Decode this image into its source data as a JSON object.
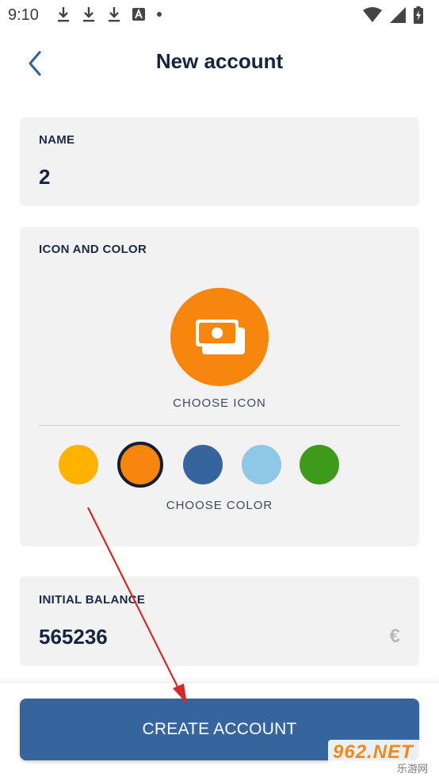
{
  "status_bar": {
    "time": "9:10",
    "left_icons": [
      "download-icon",
      "download-icon",
      "download-icon",
      "keyboard-a-icon",
      "dot-icon"
    ],
    "right_icons": [
      "wifi-icon",
      "signal-icon",
      "battery-charging-icon"
    ]
  },
  "header": {
    "title": "New account",
    "back_icon": "chevron-left-icon"
  },
  "name_section": {
    "label": "NAME",
    "value": "2"
  },
  "icon_section": {
    "label": "ICON AND COLOR",
    "icon": "money-stack-icon",
    "choose_icon_label": "CHOOSE ICON",
    "choose_color_label": "CHOOSE COLOR",
    "colors": [
      "#ffb300",
      "#f7860f",
      "#36659e",
      "#8fc8e6",
      "#3e9a1a"
    ],
    "selected_color": "#f7860f"
  },
  "balance_section": {
    "label": "INITIAL BALANCE",
    "value": "565236",
    "currency_symbol": "€"
  },
  "create_button": {
    "label": "CREATE ACCOUNT"
  },
  "accent_colors": {
    "primary": "#36659e",
    "selected_icon_bg": "#f7860f",
    "arrow": "#d42a2a"
  },
  "watermark": {
    "top": "962.NET",
    "bottom": "乐游网"
  }
}
